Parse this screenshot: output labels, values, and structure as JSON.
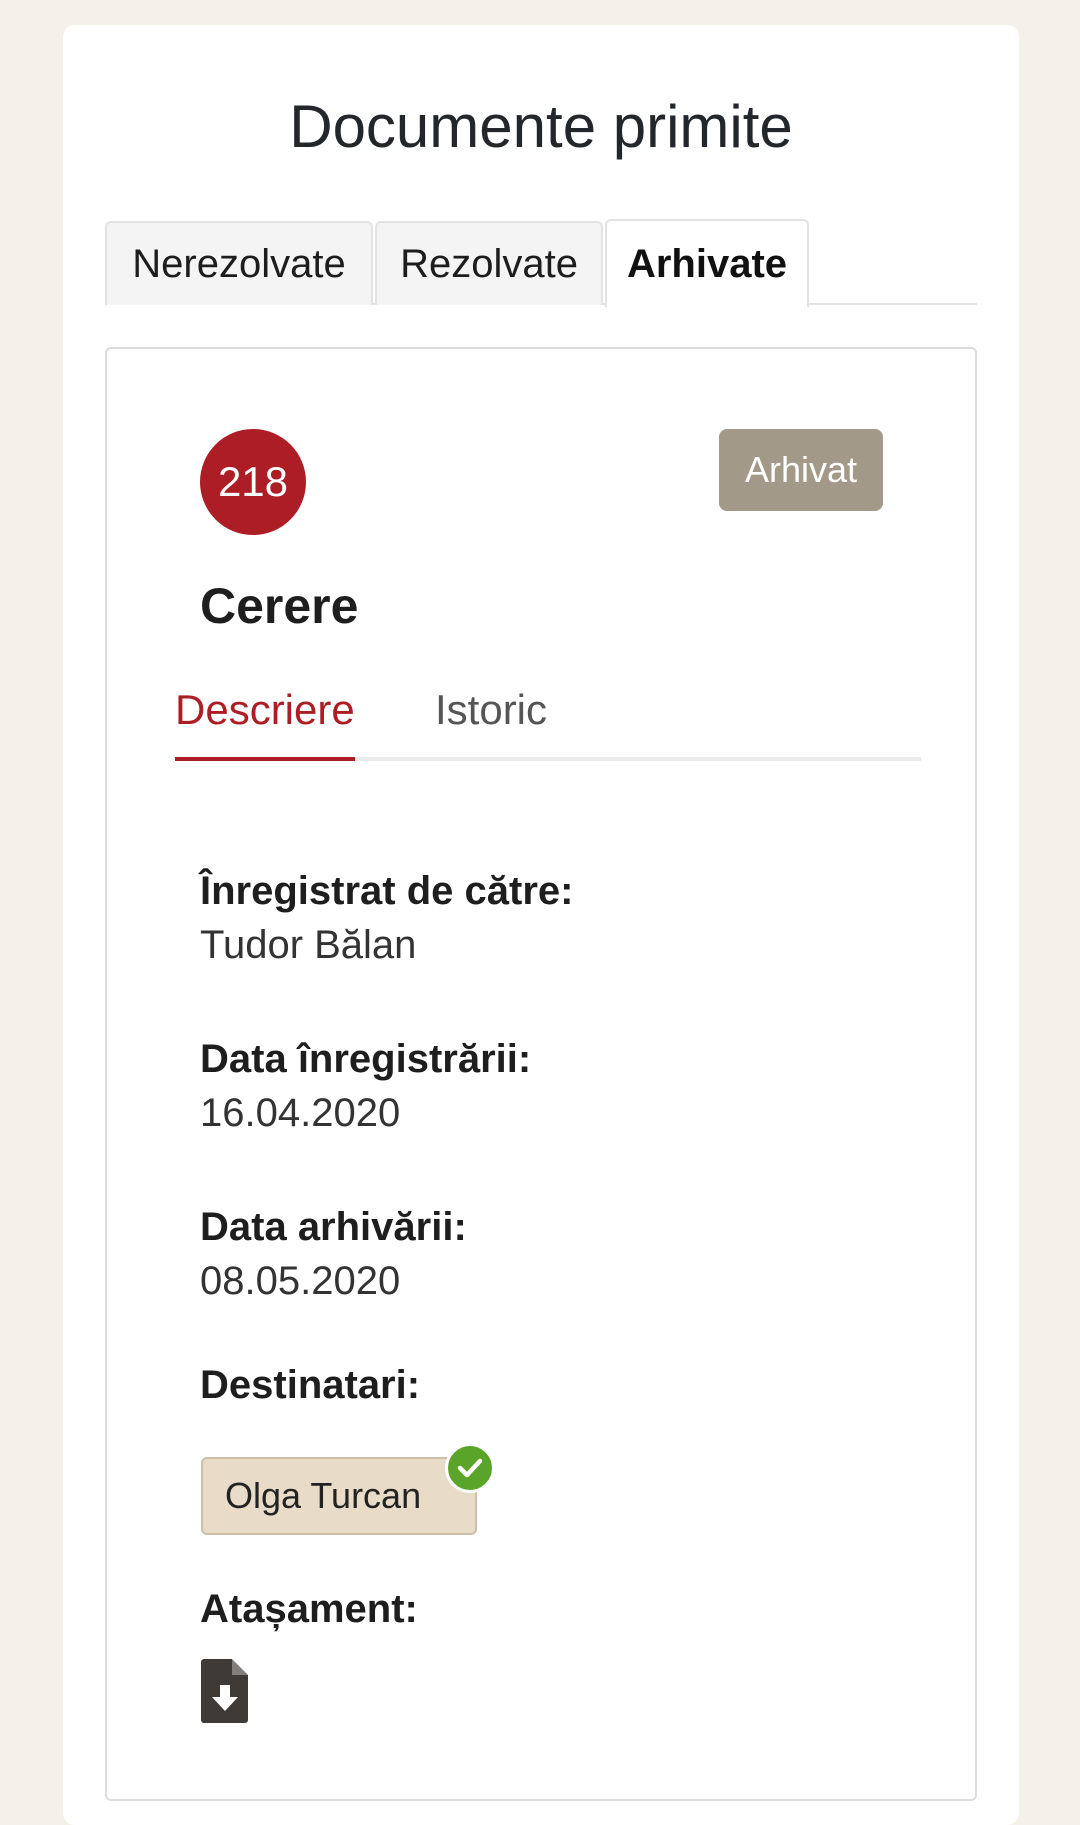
{
  "header": {
    "title": "Documente primite"
  },
  "tabs": [
    {
      "label": "Nerezolvate",
      "active": false
    },
    {
      "label": "Rezolvate",
      "active": false
    },
    {
      "label": "Arhivate",
      "active": true
    }
  ],
  "document": {
    "number": "218",
    "status": "Arhivat",
    "title": "Cerere",
    "subtabs": [
      {
        "label": "Descriere",
        "active": true
      },
      {
        "label": "Istoric",
        "active": false
      }
    ],
    "fields": {
      "registered_by_label": "Înregistrat de către:",
      "registered_by_value": "Tudor Bălan",
      "registration_date_label": "Data înregistrării:",
      "registration_date_value": "16.04.2020",
      "archive_date_label": "Data arhivării:",
      "archive_date_value": "08.05.2020",
      "recipients_label": "Destinatari:",
      "attachment_label": "Atașament:"
    },
    "recipients": [
      {
        "name": "Olga Turcan",
        "confirmed": true
      }
    ],
    "attachment_icon": "file-download-icon"
  },
  "colors": {
    "accent": "#ad1d25",
    "status_badge": "#a39989",
    "recipient_chip": "#e8dcc8",
    "confirmed_check": "#5aa42a",
    "page_background": "#f4f0ea"
  }
}
